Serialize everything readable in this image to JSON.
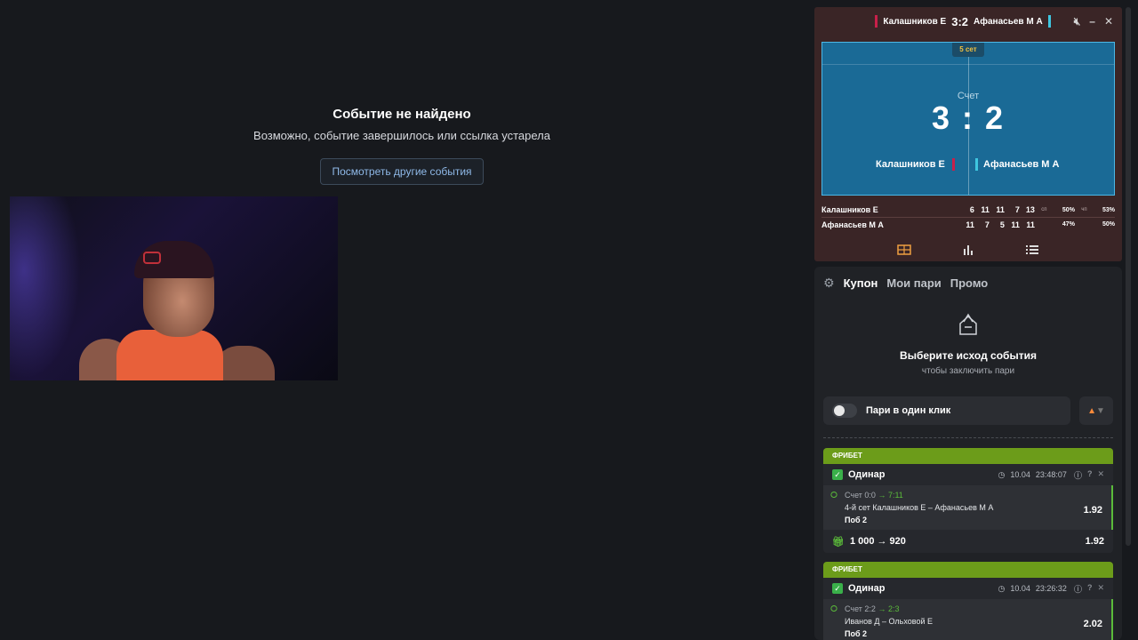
{
  "notfound": {
    "title": "Событие не найдено",
    "subtitle": "Возможно, событие завершилось или ссылка устарела",
    "button": "Посмотреть другие события"
  },
  "scoreboard": {
    "header": {
      "p1": "Калашников Е",
      "score": "3:2",
      "p2": "Афанасьев М А"
    },
    "set_badge": "5 сет",
    "score_label": "Счет",
    "score": "3 : 2",
    "p1": "Калашников Е",
    "p2": "Афанасьев М А",
    "sets": [
      {
        "name": "Калашников Е",
        "vals": [
          "6",
          "11",
          "11",
          "7",
          "13"
        ],
        "stat": "сп",
        "pct1": "50%",
        "stat2": "чп",
        "pct2": "53%"
      },
      {
        "name": "Афанасьев М А",
        "vals": [
          "11",
          "7",
          "5",
          "11",
          "11"
        ],
        "stat": "",
        "pct1": "47%",
        "stat2": "",
        "pct2": "50%"
      }
    ]
  },
  "coupon": {
    "tabs": [
      "Купон",
      "Мои пари",
      "Промо"
    ],
    "empty_title": "Выберите исход события",
    "empty_sub": "чтобы заключить пари",
    "oneclick": "Пари в один клик"
  },
  "bets": [
    {
      "header": "ФРИБЕТ",
      "type": "Одинар",
      "date": "10.04",
      "time": "23:48:07",
      "score_prefix": "Счет 0:0",
      "score_arrow": "→ 7:11",
      "event": "4-й сет Калашников Е – Афанасьев М А",
      "pick": "Поб 2",
      "odds": "1.92",
      "sum_from": "1 000",
      "sum_to": "920",
      "sum_odds": "1.92"
    },
    {
      "header": "ФРИБЕТ",
      "type": "Одинар",
      "date": "10.04",
      "time": "23:26:32",
      "score_prefix": "Счет 2:2",
      "score_arrow": "→ 2:3",
      "event": "Иванов Д – Ольховой Е",
      "pick": "Поб 2",
      "odds": "2.02"
    }
  ],
  "colors": {
    "freebet": "#6c9c1a",
    "court": "#1a6a96",
    "accent_red": "#c8204a",
    "accent_cyan": "#3ec6e0"
  }
}
